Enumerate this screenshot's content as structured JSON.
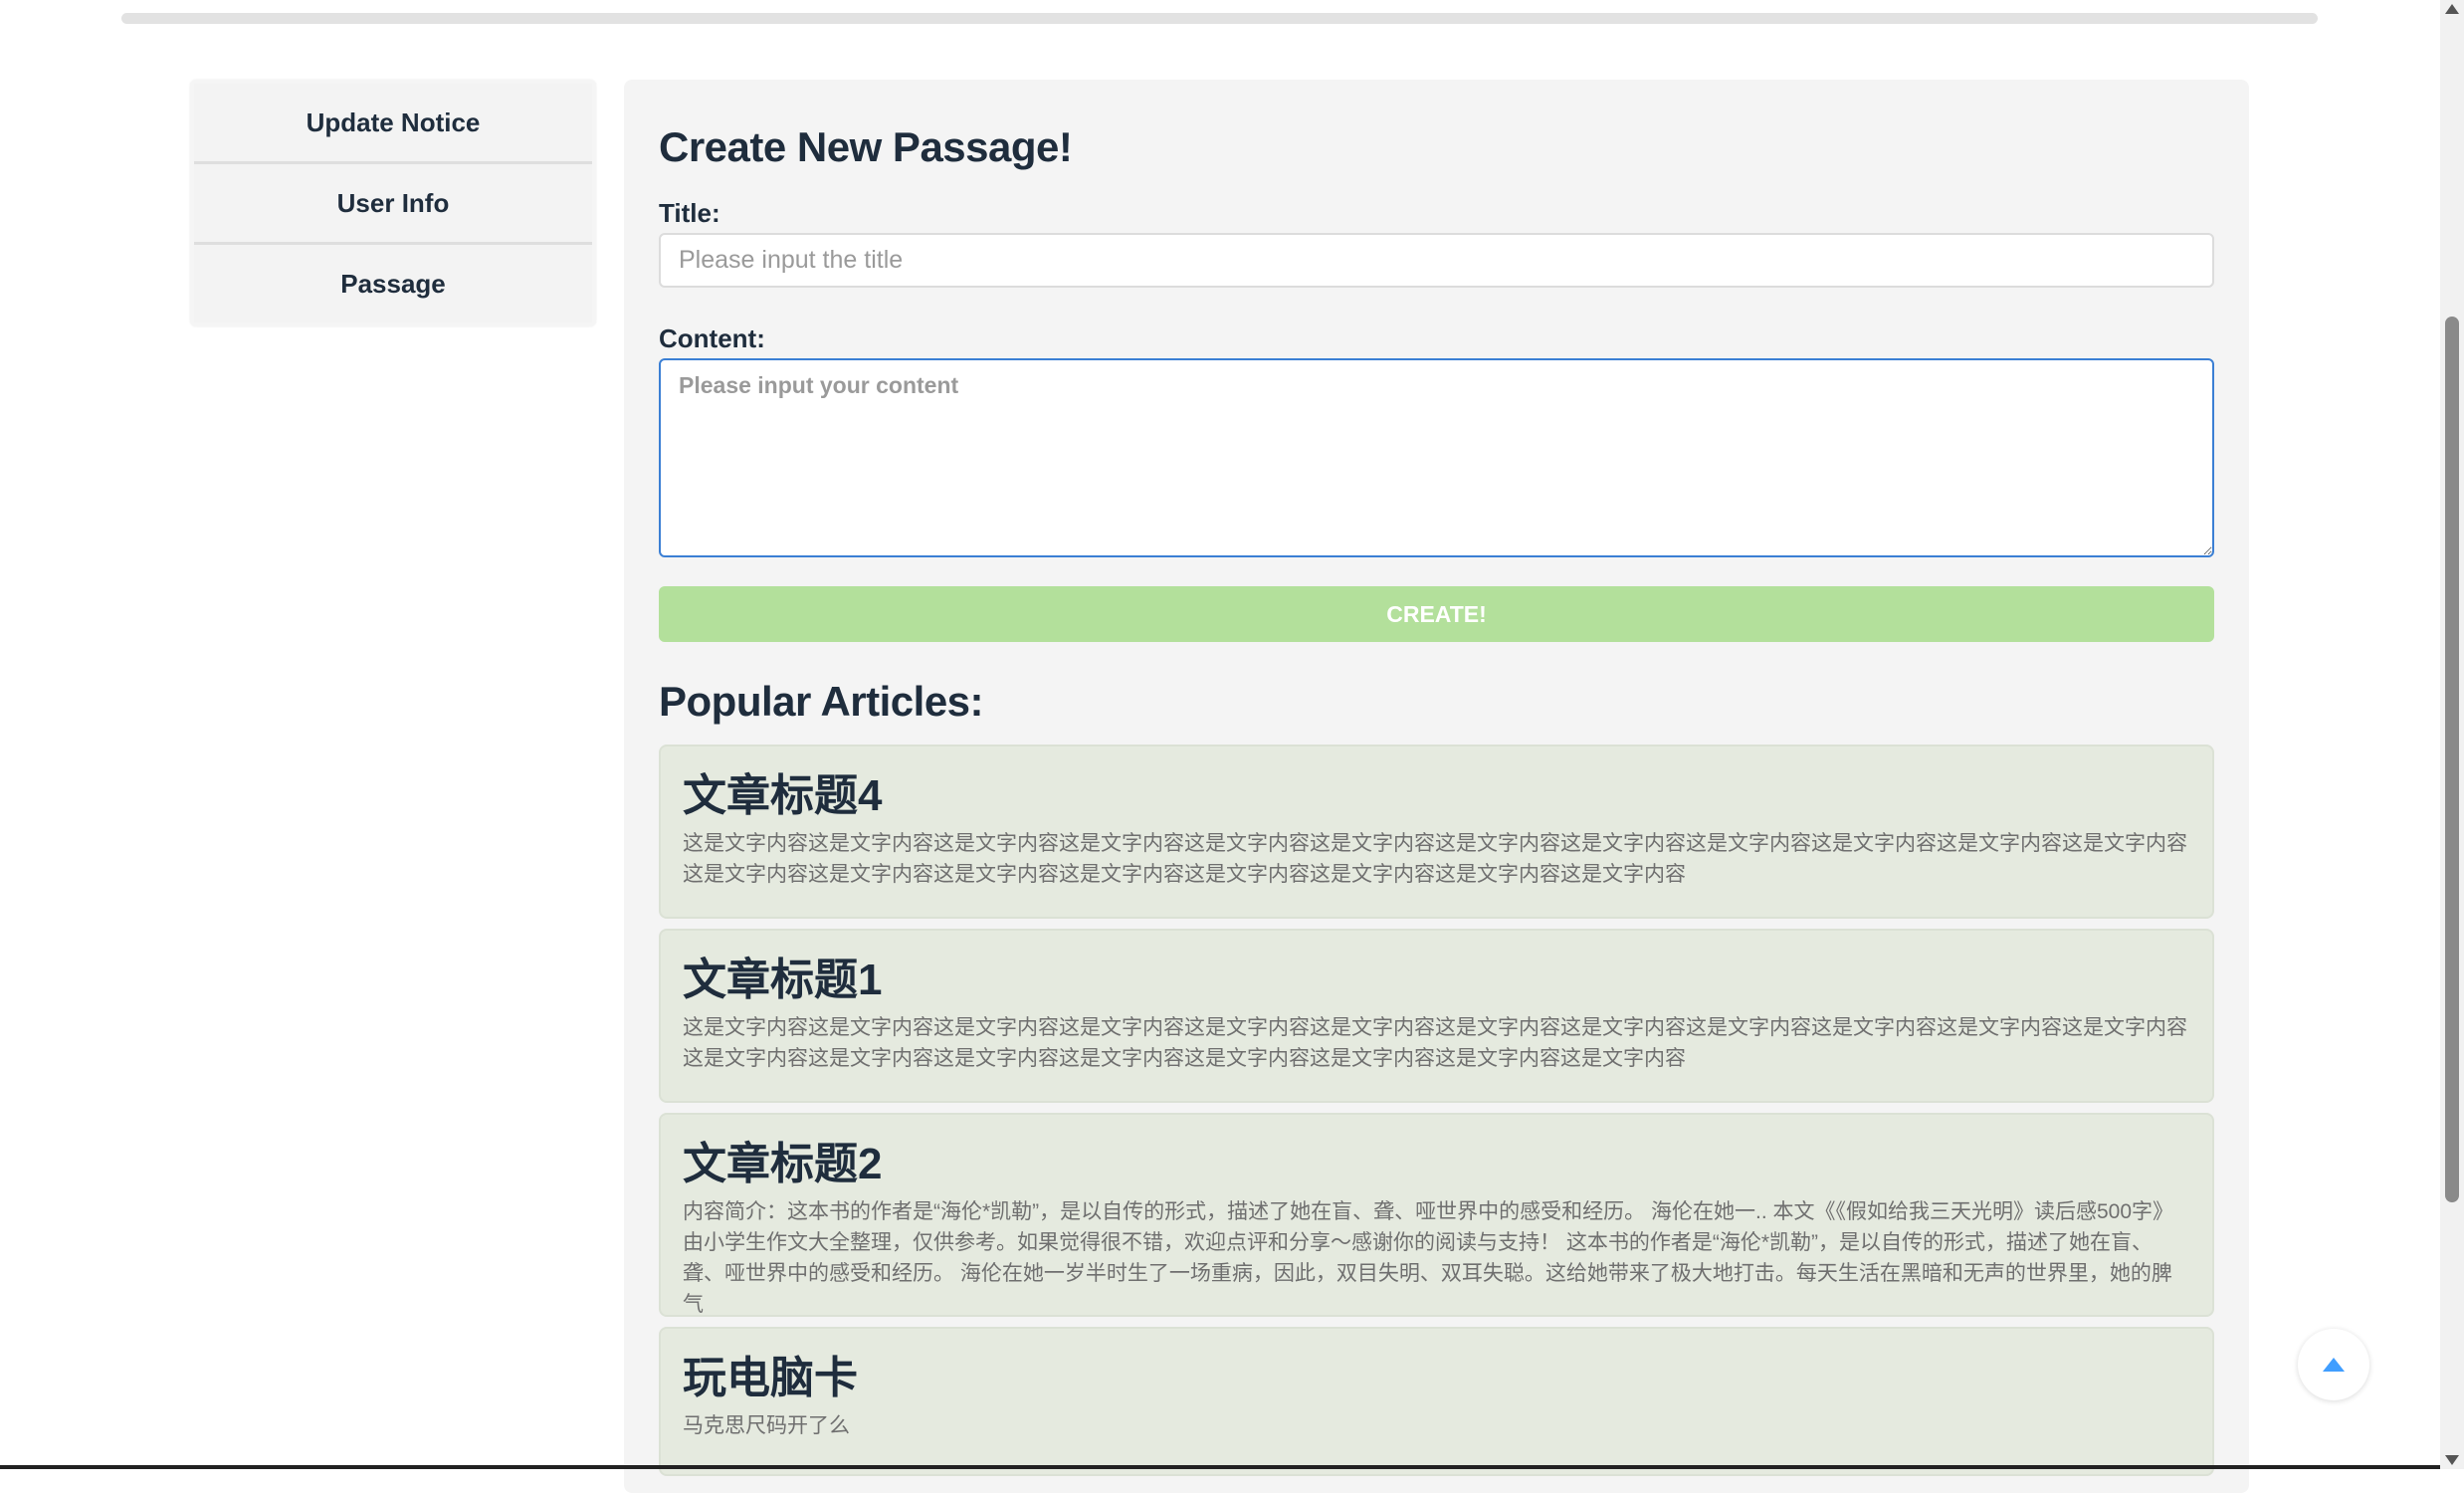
{
  "sidebar": {
    "items": [
      {
        "label": "Update Notice"
      },
      {
        "label": "User Info"
      },
      {
        "label": "Passage"
      }
    ]
  },
  "create_form": {
    "heading": "Create New Passage!",
    "title_label": "Title:",
    "title_placeholder": "Please input the title",
    "content_label": "Content:",
    "content_placeholder": "Please input your content",
    "create_button": "CREATE!"
  },
  "popular": {
    "heading": "Popular Articles:",
    "articles": [
      {
        "title": "文章标题4",
        "body": "这是文字内容这是文字内容这是文字内容这是文字内容这是文字内容这是文字内容这是文字内容这是文字内容这是文字内容这是文字内容这是文字内容这是文字内容这是文字内容这是文字内容这是文字内容这是文字内容这是文字内容这是文字内容这是文字内容这是文字内容"
      },
      {
        "title": "文章标题1",
        "body": "这是文字内容这是文字内容这是文字内容这是文字内容这是文字内容这是文字内容这是文字内容这是文字内容这是文字内容这是文字内容这是文字内容这是文字内容这是文字内容这是文字内容这是文字内容这是文字内容这是文字内容这是文字内容这是文字内容这是文字内容"
      },
      {
        "title": "文章标题2",
        "body": "内容简介：这本书的作者是“海伦*凯勒”，是以自传的形式，描述了她在盲、聋、哑世界中的感受和经历。 海伦在她一.. 本文《《假如给我三天光明》读后感500字》由小学生作文大全整理，仅供参考。如果觉得很不错，欢迎点评和分享～感谢你的阅读与支持！ 这本书的作者是“海伦*凯勒”，是以自传的形式，描述了她在盲、聋、哑世界中的感受和经历。 海伦在她一岁半时生了一场重病，因此，双目失明、双耳失聪。这给她带来了极大地打击。每天生活在黑暗和无声的世界里，她的脾气"
      },
      {
        "title": "玩电脑卡",
        "body": "马克思尺码开了么"
      }
    ]
  }
}
